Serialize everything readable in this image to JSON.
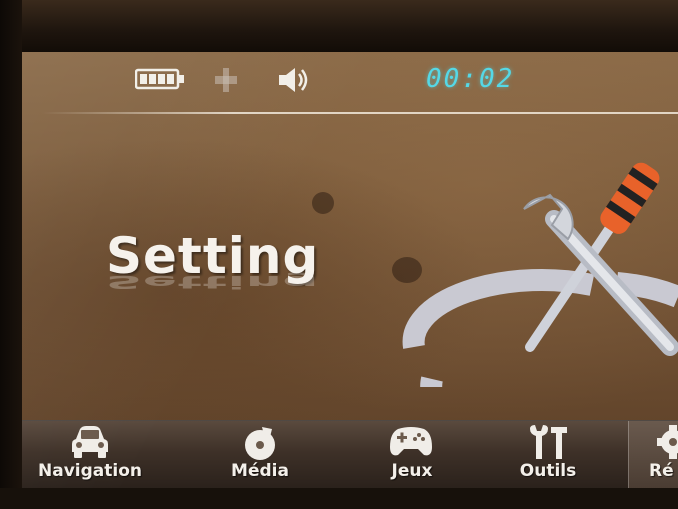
{
  "status": {
    "clock": "00:02",
    "battery_icon": "battery-icon",
    "signal_icon": "signal-icon",
    "volume_icon": "speaker-icon"
  },
  "page": {
    "title": "Setting",
    "graphic_icon": "tools-icon"
  },
  "dock": {
    "items": [
      {
        "label": "Navigation",
        "icon": "car-icon"
      },
      {
        "label": "Média",
        "icon": "media-icon"
      },
      {
        "label": "Jeux",
        "icon": "gamepad-icon"
      },
      {
        "label": "Outils",
        "icon": "tools-icon"
      },
      {
        "label": "Ré",
        "icon": "gear-icon",
        "selected": true
      }
    ]
  },
  "colors": {
    "clock": "#55d8e6",
    "screen_bg": "#7a5a3a",
    "dock_bg": "#3e3128",
    "accent_orange": "#e8622a"
  }
}
